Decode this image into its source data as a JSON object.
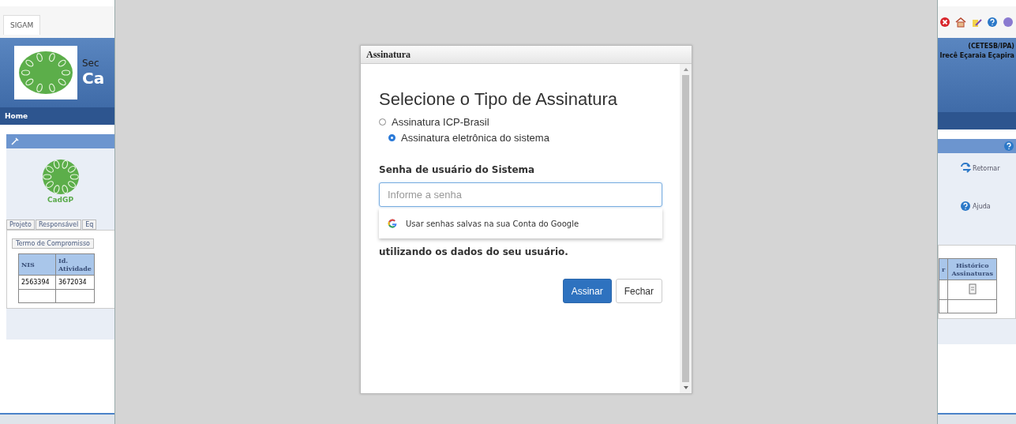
{
  "background_app": {
    "left": {
      "tab": "SIGAM",
      "header_line_1": "Sec",
      "header_line_2": "Ca",
      "nav": "Home",
      "logo_caption": "CadGP",
      "tabs": [
        {
          "label": "Projeto"
        },
        {
          "label": "Responsável"
        },
        {
          "label": "Eq"
        }
      ],
      "subtab": "Termo de Compromisso",
      "table": {
        "columns": [
          "NIS",
          "Id. Atividade"
        ],
        "rows": [
          [
            "2563394",
            "3672034"
          ]
        ]
      }
    },
    "right": {
      "org": "(CETESB/IPA)",
      "user": "Irecê Eçaraia Eçapira",
      "toolbar": [
        {
          "kind": "close"
        },
        {
          "kind": "home"
        },
        {
          "kind": "edit"
        },
        {
          "kind": "help"
        },
        {
          "kind": "other"
        }
      ],
      "actions": [
        {
          "label": "Retornar",
          "kind": "return"
        },
        {
          "label": "Ajuda",
          "kind": "help"
        }
      ],
      "table": {
        "columns": [
          "r",
          "Histórico Assinaturas"
        ]
      }
    }
  },
  "dialog": {
    "title": "Assinatura",
    "heading": "Selecione o Tipo de Assinatura",
    "options": [
      {
        "label": "Assinatura ICP-Brasil",
        "selected": false
      },
      {
        "label": "Assinatura eletrônica do sistema",
        "selected": true
      }
    ],
    "password_label": "Senha de usuário do Sistema",
    "password_field": {
      "placeholder": "Informe a senha"
    },
    "autofill_suggestion": "Usar senhas salvas na sua Conta do Google",
    "note": "utilizando os dados do seu usuário.",
    "buttons": [
      {
        "label": "Assinar",
        "kind": "primary"
      },
      {
        "label": "Fechar",
        "kind": "default"
      }
    ]
  }
}
